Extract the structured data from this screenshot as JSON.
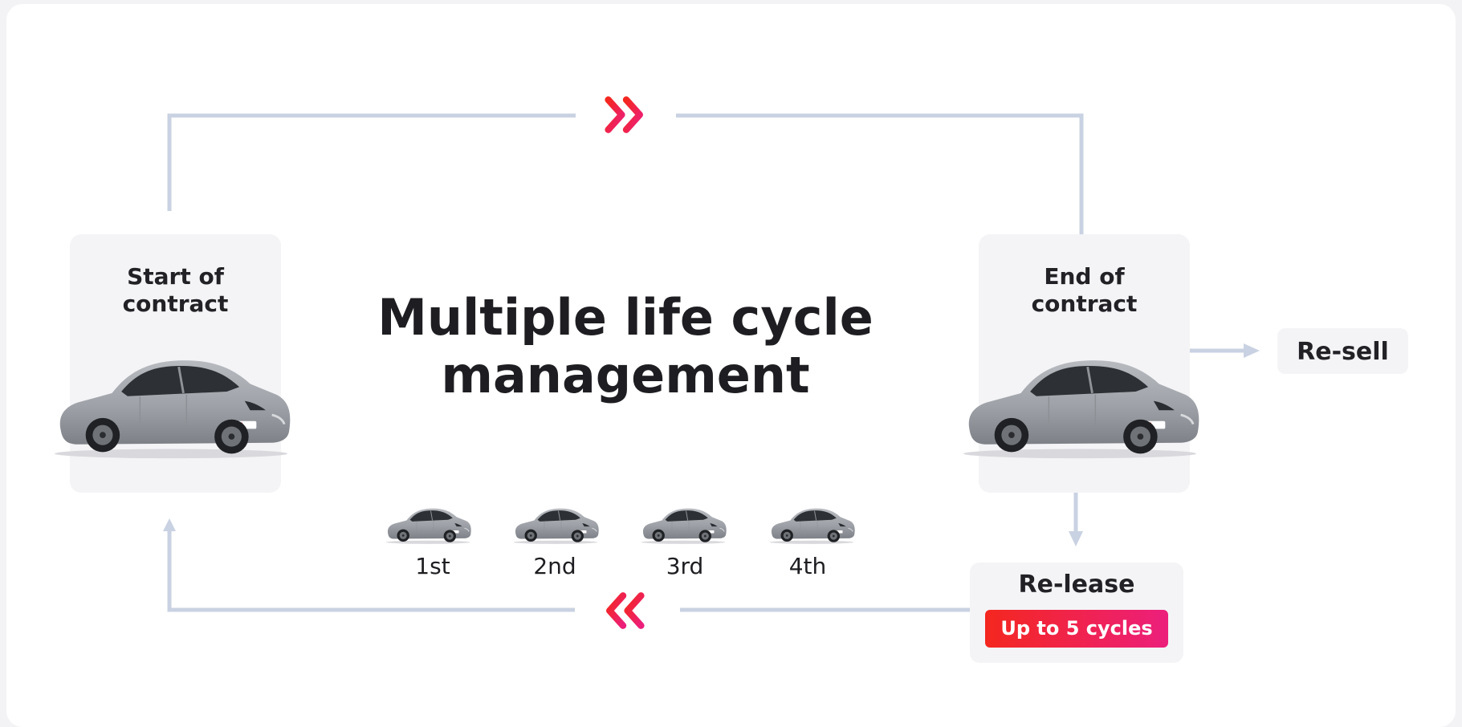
{
  "title": {
    "line1": "Multiple life cycle",
    "line2": "management"
  },
  "start_card": {
    "line1": "Start of",
    "line2": "contract"
  },
  "end_card": {
    "line1": "End of",
    "line2": "contract"
  },
  "cycles": [
    "1st",
    "2nd",
    "3rd",
    "4th"
  ],
  "resell": {
    "label": "Re-sell"
  },
  "release": {
    "label": "Re-lease",
    "badge": "Up to 5 cycles"
  },
  "icons": {
    "top": "forward-double-chevron-icon",
    "bottom": "backward-double-chevron-icon",
    "car": "grey-electric-hatchback-car-icon"
  },
  "colors": {
    "connector": "#c9d2e2",
    "accent_start": "#f4271f",
    "accent_end": "#ec1f7c",
    "card_bg": "#f4f4f6"
  }
}
